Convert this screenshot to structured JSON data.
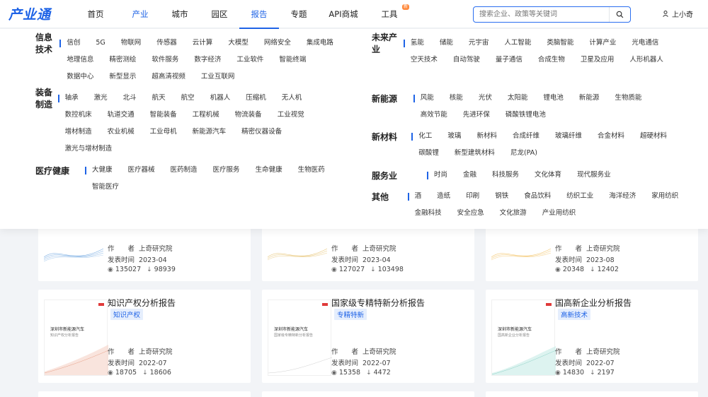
{
  "logo": "产业通",
  "nav": [
    {
      "label": "首页"
    },
    {
      "label": "产业"
    },
    {
      "label": "城市"
    },
    {
      "label": "园区"
    },
    {
      "label": "报告"
    },
    {
      "label": "专题"
    },
    {
      "label": "API商城"
    },
    {
      "label": "工具"
    }
  ],
  "nav_badge": "新",
  "search_placeholder": "搜索企业、政策等关键词",
  "user_name": "上小奇",
  "colors": {
    "accent": "#1e63e6",
    "badge": "#ff8a3d"
  },
  "categories": [
    {
      "title": "信息技术",
      "items": [
        "信创",
        "5G",
        "物联网",
        "传感器",
        "云计算",
        "大模型",
        "网络安全",
        "集成电路",
        "地理信息",
        "精密测绘",
        "软件服务",
        "数字经济",
        "工业软件",
        "智能终端",
        "数据中心",
        "新型显示",
        "超高清视频",
        "工业互联网"
      ]
    },
    {
      "title": "装备制造",
      "items": [
        "轴承",
        "激光",
        "北斗",
        "航天",
        "航空",
        "机器人",
        "压缩机",
        "无人机",
        "数控机床",
        "轨道交通",
        "智能装备",
        "工程机械",
        "物流装备",
        "工业视觉",
        "增材制造",
        "农业机械",
        "工业母机",
        "新能源汽车",
        "精密仪器设备",
        "激光与增材制造"
      ]
    },
    {
      "title": "医疗健康",
      "items": [
        "大健康",
        "医疗器械",
        "医药制造",
        "医疗服务",
        "生命健康",
        "生物医药",
        "智能医疗"
      ]
    },
    {
      "title": "未来产业",
      "items": [
        "氢能",
        "储能",
        "元宇宙",
        "人工智能",
        "类脑智能",
        "计算产业",
        "光电通信",
        "空天技术",
        "自动驾驶",
        "量子通信",
        "合成生物",
        "卫星及应用",
        "人形机器人"
      ]
    },
    {
      "title": "新能源",
      "items": [
        "风能",
        "核能",
        "光伏",
        "太阳能",
        "锂电池",
        "新能源",
        "生物质能",
        "高效节能",
        "先进环保",
        "磷酸铁锂电池"
      ]
    },
    {
      "title": "新材料",
      "items": [
        "化工",
        "玻璃",
        "新材料",
        "合成纤维",
        "玻璃纤维",
        "合金材料",
        "超硬材料",
        "碳酸锂",
        "新型建筑材料",
        "尼龙(PA)"
      ]
    },
    {
      "title": "服务业",
      "items": [
        "时尚",
        "金融",
        "科技服务",
        "文化体育",
        "现代服务业"
      ]
    },
    {
      "title": "其他",
      "items": [
        "酒",
        "造纸",
        "印刷",
        "钢铁",
        "食品饮料",
        "纺织工业",
        "海洋经济",
        "家用纺织",
        "金融科技",
        "安全应急",
        "文化旅游",
        "产业用纺织"
      ]
    }
  ],
  "cards": [
    {
      "author_label": "作　　者",
      "author": "上奇研究院",
      "date_label": "发表时间",
      "date": "2023-04",
      "views": "135027",
      "downloads": "98939"
    },
    {
      "author_label": "作　　者",
      "author": "上奇研究院",
      "date_label": "发表时间",
      "date": "2023-04",
      "views": "127027",
      "downloads": "103498"
    },
    {
      "author_label": "作　　者",
      "author": "上奇研究院",
      "date_label": "发表时间",
      "date": "2023-08",
      "views": "20348",
      "downloads": "12402"
    },
    {
      "title": "知识产权分析报告",
      "tag": "知识产权",
      "thumb_title": "深圳市新能源汽车",
      "thumb_sub": "知识产权分析报告",
      "author_label": "作　　者",
      "author": "上奇研究院",
      "date_label": "发表时间",
      "date": "2022-07",
      "views": "18705",
      "downloads": "18606"
    },
    {
      "title": "国家级专精特新分析报告",
      "tag": "专精特新",
      "thumb_title": "深圳市新能源汽车",
      "thumb_sub": "国家级专精特新分析报告",
      "author_label": "作　　者",
      "author": "上奇研究院",
      "date_label": "发表时间",
      "date": "2022-07",
      "views": "15358",
      "downloads": "4472"
    },
    {
      "title": "国高新企业分析报告",
      "tag": "高新技术",
      "thumb_title": "深圳市新能源汽车",
      "thumb_sub": "国高新企业分析报告",
      "author_label": "作　　者",
      "author": "上奇研究院",
      "date_label": "发表时间",
      "date": "2022-07",
      "views": "14830",
      "downloads": "2197"
    }
  ]
}
